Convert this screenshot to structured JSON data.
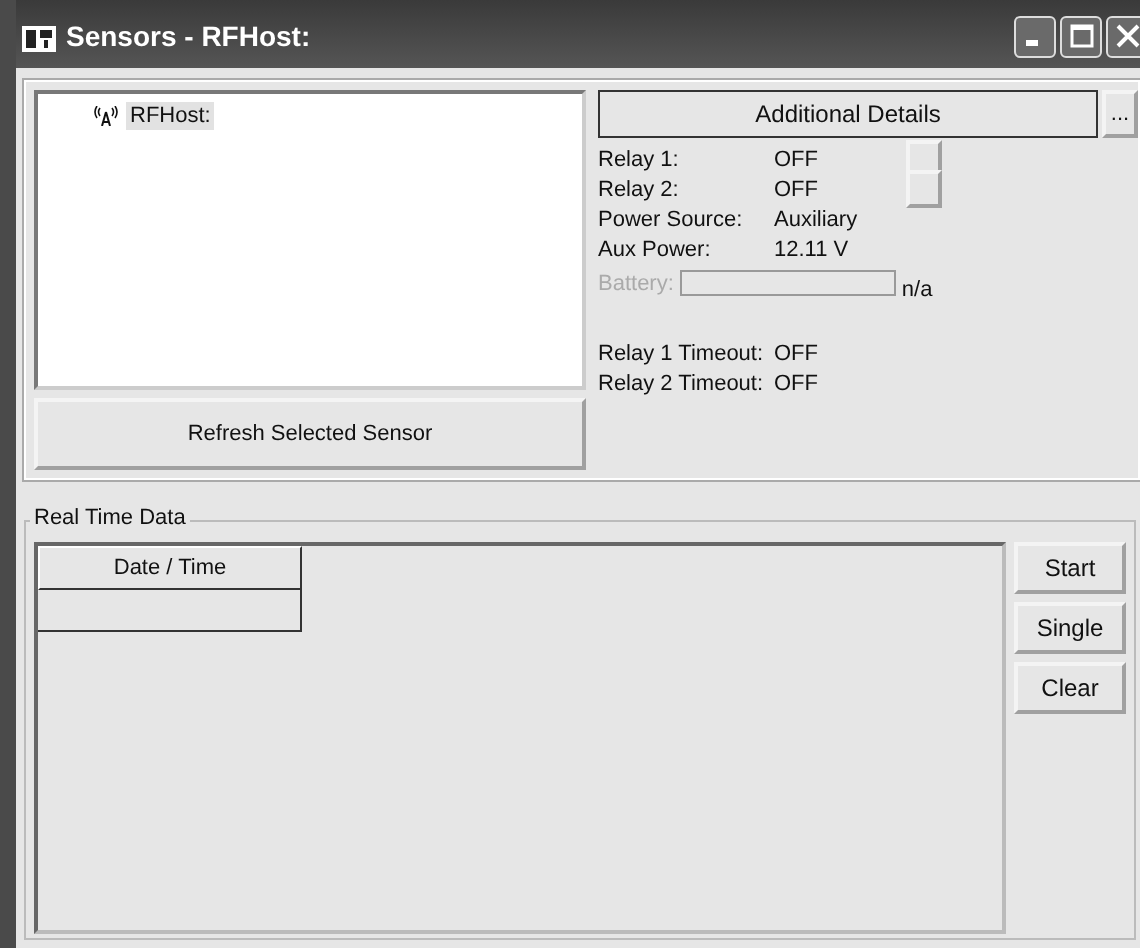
{
  "window": {
    "title": "Sensors - RFHost:"
  },
  "tree": {
    "items": [
      {
        "label": "RFHost:",
        "selected": true
      }
    ]
  },
  "refresh_button": "Refresh Selected Sensor",
  "details_button": "Additional Details",
  "more_button": "...",
  "details": [
    {
      "label": "Relay 1:",
      "value": "OFF",
      "kind": "relay"
    },
    {
      "label": "Relay 2:",
      "value": "OFF",
      "kind": "relay"
    },
    {
      "label": "Power Source:",
      "value": "Auxiliary",
      "kind": "plain"
    },
    {
      "label": "Aux Power:",
      "value": "12.11 V",
      "kind": "plain"
    }
  ],
  "battery": {
    "label": "Battery:",
    "disabled": true,
    "level": 0,
    "reading": "n/a"
  },
  "timeouts": [
    {
      "label": "Relay 1 Timeout:",
      "value": "OFF"
    },
    {
      "label": "Relay 2 Timeout:",
      "value": "OFF"
    }
  ],
  "real_time": {
    "title": "Real Time Data",
    "columns": [
      "Date / Time"
    ],
    "buttons": [
      "Start",
      "Single",
      "Clear"
    ]
  }
}
